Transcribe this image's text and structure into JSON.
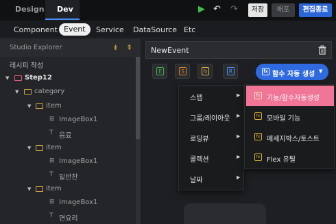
{
  "topbar": {
    "tabs": [
      "Design",
      "Dev"
    ],
    "save_label": "저장",
    "deploy_label": "배포",
    "exit_label": "편집종료"
  },
  "subnav": {
    "items": [
      "Component",
      "Event",
      "Service",
      "DataSource",
      "Etc"
    ]
  },
  "explorer": {
    "title": "Studio Explorer",
    "section": "레시피 작성",
    "root": "Step12",
    "tree": [
      {
        "label": "category"
      },
      {
        "label": "item"
      },
      {
        "label": "ImageBox1"
      },
      {
        "label": "음료"
      },
      {
        "label": "item"
      },
      {
        "label": "ImageBox1"
      },
      {
        "label": "밑반찬"
      },
      {
        "label": "item"
      },
      {
        "label": "ImageBox1"
      },
      {
        "label": "면요리"
      }
    ]
  },
  "event_panel": {
    "name": "NewEvent",
    "buttons": [
      {
        "glyph": "E",
        "color": "#4cae4f"
      },
      {
        "glyph": "S",
        "color": "#d9822b"
      },
      {
        "glyph": "fx",
        "color": "#e0b23c"
      },
      {
        "glyph": "R",
        "color": "#4b8df8"
      }
    ],
    "autogen_label": "함수 자동 생성"
  },
  "menu": {
    "items": [
      "스텝",
      "그룹/레이아웃",
      "로딩뷰",
      "콜렉션",
      "날짜"
    ],
    "submenu": [
      "기능/함수자동생성",
      "모바일 기능",
      "메세지박스/토스트",
      "Flex 유틸"
    ]
  },
  "colors": {
    "accent": "#2f6ae0",
    "highlight": "#f07597",
    "folder": "#d6a74a"
  }
}
